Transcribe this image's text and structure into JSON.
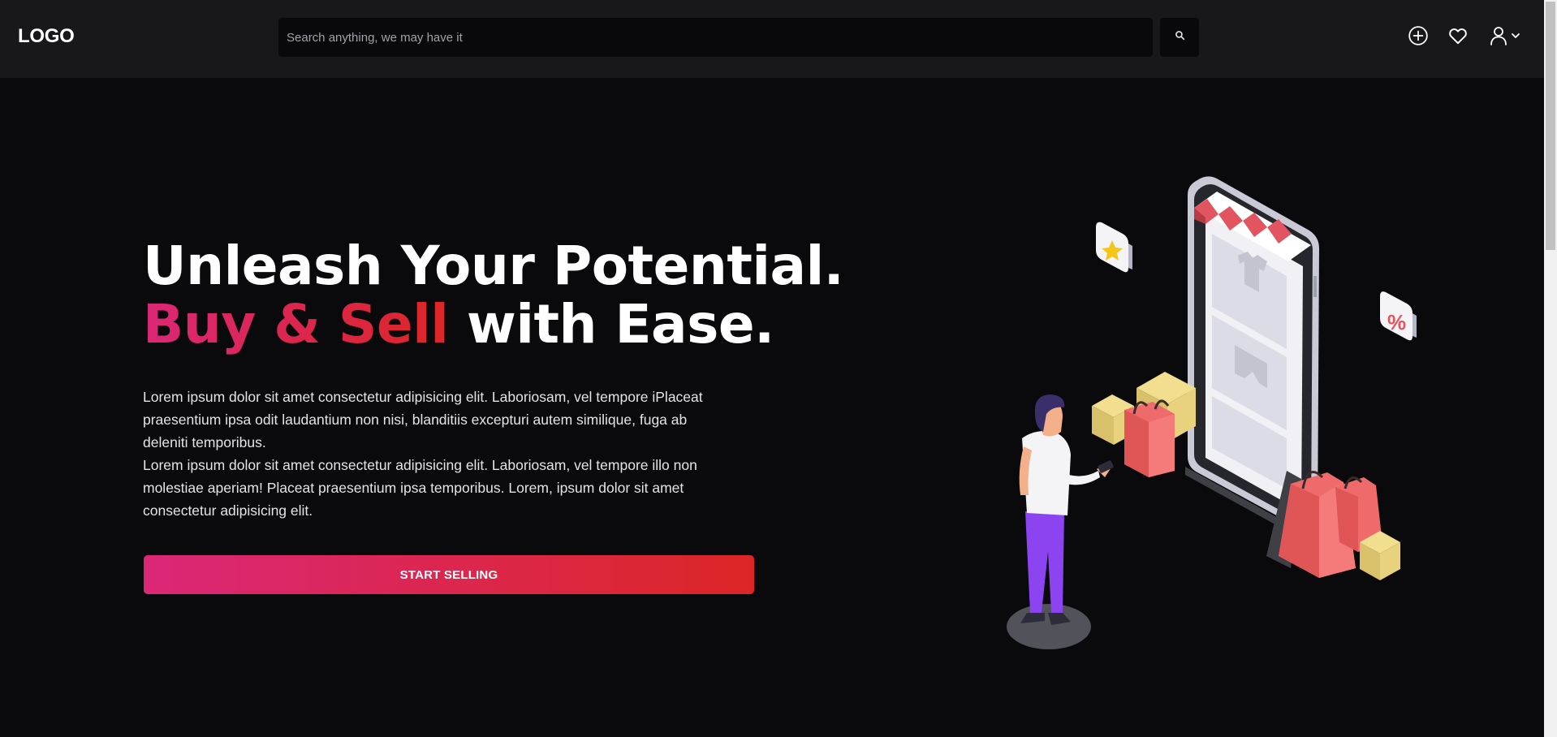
{
  "header": {
    "logo": "LOGO",
    "search_placeholder": "Search anything, we may have it",
    "icons": {
      "search": "search-icon",
      "add": "plus-circle-icon",
      "favorites": "heart-icon",
      "account": "user-icon",
      "account_dropdown": "chevron-down-icon"
    }
  },
  "hero": {
    "title_line1": "Unleash Your Potential.",
    "title_accent": "Buy & Sell",
    "title_rest": " with Ease.",
    "paragraph1": "Lorem ipsum dolor sit amet consectetur adipisicing elit. Laboriosam, vel tempore iPlaceat praesentium ipsa odit laudantium non nisi, blanditiis excepturi autem similique, fuga ab deleniti temporibus.",
    "paragraph2": "Lorem ipsum dolor sit amet consectetur adipisicing elit. Laboriosam, vel tempore illo non molestiae aperiam! Placeat praesentium ipsa temporibus. Lorem, ipsum dolor sit amet consectetur adipisicing elit.",
    "cta_label": "START SELLING"
  },
  "illustration": {
    "badge_percent": "%"
  },
  "colors": {
    "background": "#0a0a0c",
    "navbar": "#18181b",
    "accent_start": "#db2777",
    "accent_end": "#dc2626"
  }
}
